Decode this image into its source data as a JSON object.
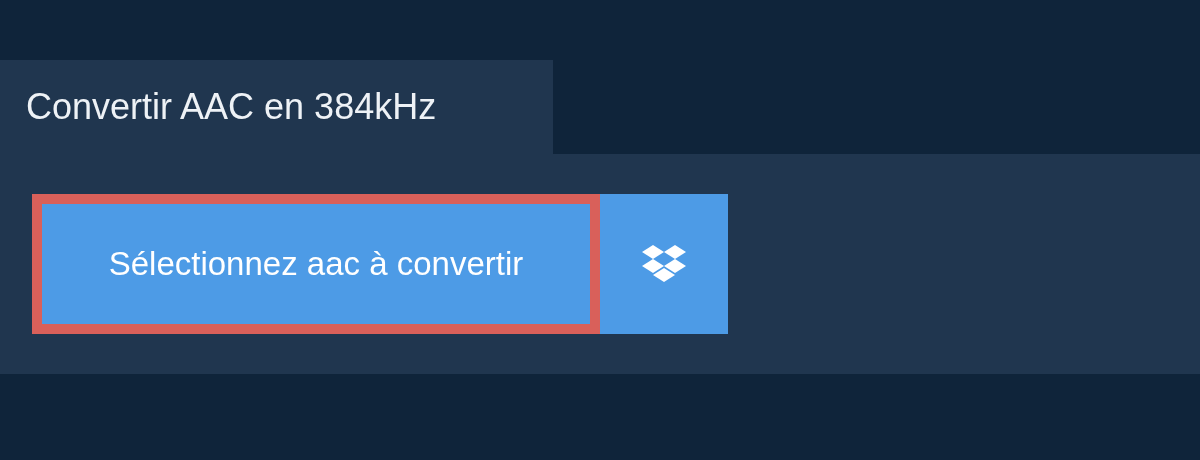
{
  "tab": {
    "title": "Convertir AAC en 384kHz"
  },
  "buttons": [
    {
      "kind": "select",
      "label": "Sélectionnez aac à convertir",
      "focused": true
    },
    {
      "kind": "dropbox",
      "focused": false
    }
  ]
}
